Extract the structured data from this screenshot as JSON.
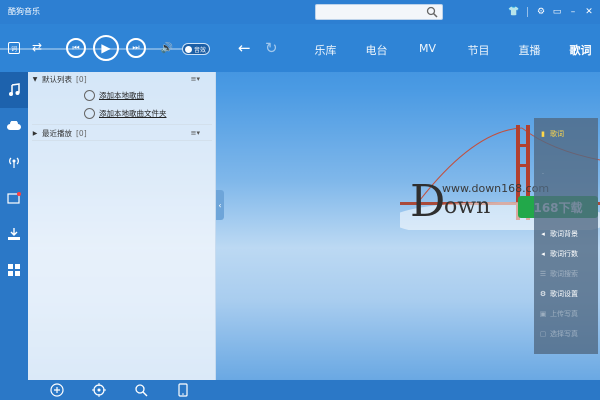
{
  "app": {
    "title": "酷狗音乐"
  },
  "search": {
    "placeholder": ""
  },
  "player": {
    "toggle_label": "音效"
  },
  "nav": {
    "tabs": [
      "乐库",
      "电台",
      "MV",
      "节目",
      "直播",
      "歌词"
    ]
  },
  "playlists": [
    {
      "name": "默认列表",
      "count": "[0]",
      "links": [
        "添加本地歌曲",
        "添加本地歌曲文件夹"
      ]
    },
    {
      "name": "最近播放",
      "count": "[0]"
    }
  ],
  "lyrics_menu": {
    "items": [
      {
        "label": "歌词",
        "state": "active"
      },
      {
        "label": "",
        "state": "dim"
      },
      {
        "label": "",
        "state": "dim"
      },
      {
        "label": "",
        "state": "normal"
      },
      {
        "label": "歌词背景",
        "state": "normal"
      },
      {
        "label": "歌词行数",
        "state": "normal"
      },
      {
        "label": "歌词搜索",
        "state": "dim"
      },
      {
        "label": "歌词设置",
        "state": "normal"
      },
      {
        "label": "上传写真",
        "state": "dim"
      },
      {
        "label": "选择写真",
        "state": "dim"
      }
    ]
  },
  "watermark": {
    "url": "www.down168.com",
    "letter": "D",
    "rest": "own",
    "badge": "168下载"
  },
  "colors": {
    "title_bar": "#2d7fd2",
    "rail": "#2b78c7",
    "active_lyric": "#ffd84a",
    "badge": "#22a84a"
  }
}
